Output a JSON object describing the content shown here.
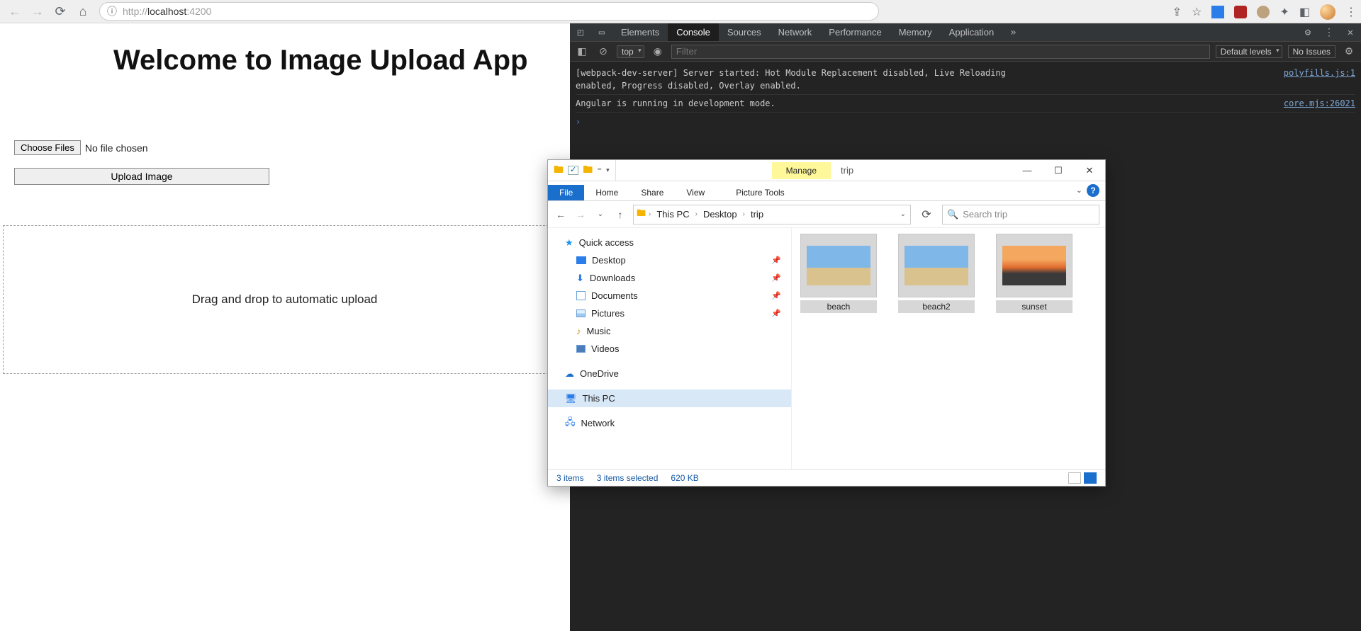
{
  "browser": {
    "url_host": "localhost",
    "url_rest": ":4200",
    "url_prefix": "http://"
  },
  "page": {
    "title": "Welcome to Image Upload App",
    "choose_files": "Choose Files",
    "no_file": "No file chosen",
    "upload_btn": "Upload Image",
    "drop_label": "Drag and drop to automatic upload"
  },
  "devtools": {
    "tabs": [
      "Elements",
      "Console",
      "Sources",
      "Network",
      "Performance",
      "Memory",
      "Application"
    ],
    "active_tab": "Console",
    "context": "top",
    "filter_placeholder": "Filter",
    "levels": "Default levels",
    "no_issues": "No Issues",
    "logs": [
      {
        "msg": "[webpack-dev-server] Server started: Hot Module Replacement disabled, Live Reloading\nenabled, Progress disabled, Overlay enabled.",
        "src": "polyfills.js:1"
      },
      {
        "msg": "Angular is running in development mode.",
        "src": "core.mjs:26021"
      }
    ]
  },
  "explorer": {
    "manage": "Manage",
    "picture_tools": "Picture Tools",
    "location_title": "trip",
    "ribbon": {
      "file": "File",
      "home": "Home",
      "share": "Share",
      "view": "View"
    },
    "breadcrumb": [
      "This PC",
      "Desktop",
      "trip"
    ],
    "search_placeholder": "Search trip",
    "tree": {
      "quick_access": "Quick access",
      "desktop": "Desktop",
      "downloads": "Downloads",
      "documents": "Documents",
      "pictures": "Pictures",
      "music": "Music",
      "videos": "Videos",
      "onedrive": "OneDrive",
      "this_pc": "This PC",
      "network": "Network"
    },
    "files": [
      {
        "name": "beach",
        "kind": "beach"
      },
      {
        "name": "beach2",
        "kind": "beach"
      },
      {
        "name": "sunset",
        "kind": "sunset"
      }
    ],
    "status": {
      "count": "3 items",
      "selected": "3 items selected",
      "size": "620 KB"
    }
  }
}
